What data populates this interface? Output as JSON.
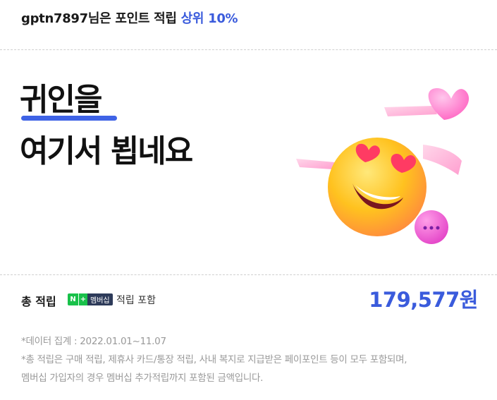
{
  "header": {
    "user": "gptn7897님은 포인트 적립",
    "rank": "상위 10%"
  },
  "hero": {
    "line1": "귀인을",
    "line2": "여기서 뵙네요"
  },
  "summary": {
    "label": "총 적립",
    "badge": {
      "n": "N",
      "plus": "+",
      "membership": "멤버십"
    },
    "include_text": "적립 포함",
    "amount": "179,577원"
  },
  "notes": [
    "*데이터 집계 : 2022.01.01~11.07",
    "*총 적립은 구매 적립, 제휴사 카드/통장 적립, 사내 복지로 지급받은 페이포인트 등이 모두 포함되며,",
    "멤버십 가입자의 경우 멤버십 추가적립까지 포함된 금액입니다."
  ],
  "colors": {
    "accent": "#3a5bdc",
    "underline": "#3f63e6",
    "naver_green": "#19c14a"
  }
}
